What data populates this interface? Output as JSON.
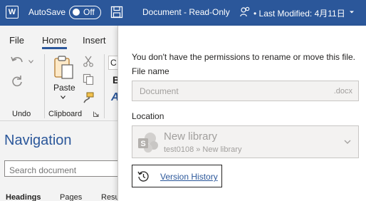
{
  "titlebar": {
    "app_icon_letter": "W",
    "autosave_label": "AutoSave",
    "autosave_state": "Off",
    "document_title": "Document  -  Read-Only",
    "last_modified": "• Last Modified: 4月11日"
  },
  "ribbon": {
    "tabs": [
      "File",
      "Home",
      "Insert"
    ],
    "active_tab": "Home",
    "paste_label": "Paste",
    "group_undo": "Undo",
    "group_clipboard": "Clipboard",
    "font_box_text": "C",
    "bold_glyph": "B",
    "text_effects_glyph": "A"
  },
  "navigation": {
    "title": "Navigation",
    "search_placeholder": "Search document",
    "tabs": [
      "Headings",
      "Pages",
      "Resu"
    ]
  },
  "flyout": {
    "permission_message": "You don't have the permissions to rename or move this file.",
    "file_name_label": "File name",
    "file_name_value": "Document",
    "file_extension": ".docx",
    "location_label": "Location",
    "location_name": "New library",
    "location_path": "test0108 » New library",
    "version_history_label": "Version History"
  },
  "colors": {
    "titlebar": "#2b579a",
    "accent": "#2b579a",
    "ribbon_bg": "#f3f3f3"
  }
}
